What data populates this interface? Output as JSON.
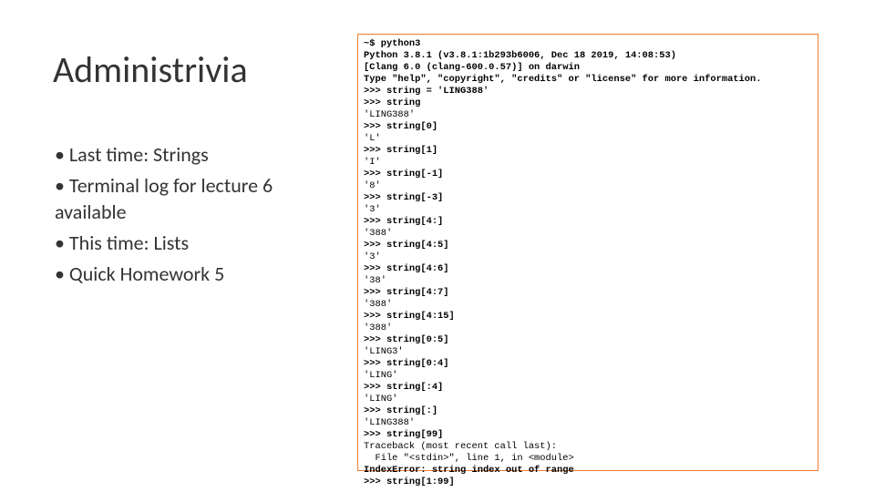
{
  "title": "Administrivia",
  "bullets": {
    "b0": "• Last time: Strings",
    "b1": "• Terminal log for lecture 6 available",
    "b2": "• This time: Lists",
    "b3": "• Quick Homework 5"
  },
  "term": {
    "l0": "~$ python3",
    "l1": "Python 3.8.1 (v3.8.1:1b293b6006, Dec 18 2019, 14:08:53)",
    "l2": "[Clang 6.0 (clang-600.0.57)] on darwin",
    "l3": "Type \"help\", \"copyright\", \"credits\" or \"license\" for more information.",
    "l4": ">>> string = 'LING388'",
    "l5": ">>> string",
    "l6": "'LING388'",
    "l7": ">>> string[0]",
    "l8": "'L'",
    "l9": ">>> string[1]",
    "l10": "'I'",
    "l11": ">>> string[-1]",
    "l12": "'8'",
    "l13": ">>> string[-3]",
    "l14": "'3'",
    "l15": ">>> string[4:]",
    "l16": "'388'",
    "l17": ">>> string[4:5]",
    "l18": "'3'",
    "l19": ">>> string[4:6]",
    "l20": "'38'",
    "l21": ">>> string[4:7]",
    "l22": "'388'",
    "l23": ">>> string[4:15]",
    "l24": "'388'",
    "l25": ">>> string[0:5]",
    "l26": "'LING3'",
    "l27": ">>> string[0:4]",
    "l28": "'LING'",
    "l29": ">>> string[:4]",
    "l30": "'LING'",
    "l31": ">>> string[:]",
    "l32": "'LING388'",
    "l33": ">>> string[99]",
    "l34": "Traceback (most recent call last):",
    "l35": "  File \"<stdin>\", line 1, in <module>",
    "l36": "IndexError: string index out of range",
    "l37": ">>> string[1:99]"
  }
}
